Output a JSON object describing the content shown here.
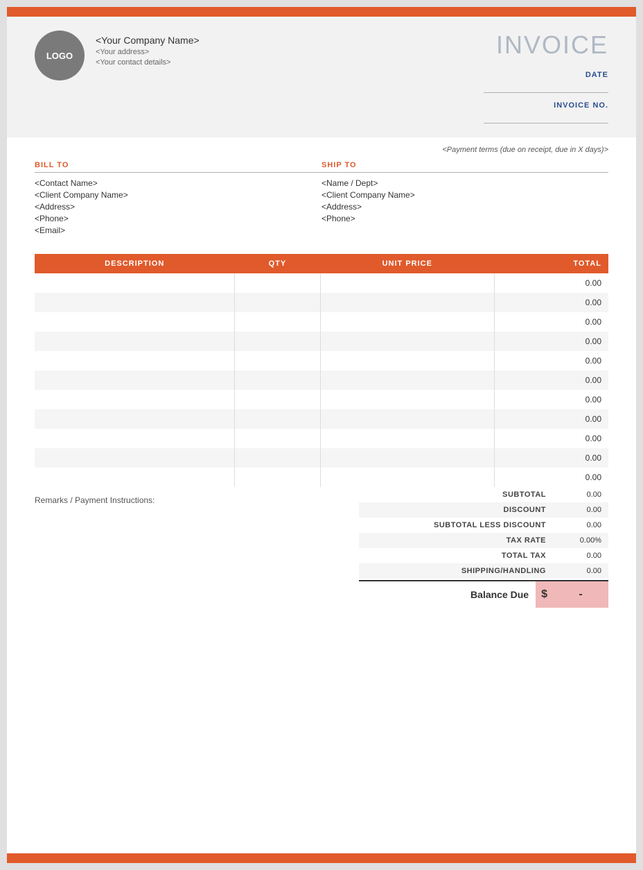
{
  "topBar": {
    "color": "#e05a2b"
  },
  "header": {
    "logo": {
      "label": "LOGO"
    },
    "company": {
      "name": "<Your Company Name>",
      "address": "<Your address>",
      "contact": "<Your contact details>"
    },
    "invoiceTitle": "INVOICE",
    "dateLabel": "DATE",
    "invoiceNoLabel": "INVOICE NO."
  },
  "paymentTerms": "<Payment terms (due on receipt, due in X days)>",
  "billTo": {
    "sectionTitle": "BILL TO",
    "contactName": "<Contact Name>",
    "companyName": "<Client Company Name>",
    "address": "<Address>",
    "phone": "<Phone>",
    "email": "<Email>"
  },
  "shipTo": {
    "sectionTitle": "SHIP TO",
    "nameDept": "<Name / Dept>",
    "companyName": "<Client Company Name>",
    "address": "<Address>",
    "phone": "<Phone>"
  },
  "table": {
    "headers": {
      "description": "DESCRIPTION",
      "qty": "QTY",
      "unitPrice": "UNIT PRICE",
      "total": "TOTAL"
    },
    "rows": [
      {
        "description": "",
        "qty": "",
        "unitPrice": "",
        "total": "0.00"
      },
      {
        "description": "",
        "qty": "",
        "unitPrice": "",
        "total": "0.00"
      },
      {
        "description": "",
        "qty": "",
        "unitPrice": "",
        "total": "0.00"
      },
      {
        "description": "",
        "qty": "",
        "unitPrice": "",
        "total": "0.00"
      },
      {
        "description": "",
        "qty": "",
        "unitPrice": "",
        "total": "0.00"
      },
      {
        "description": "",
        "qty": "",
        "unitPrice": "",
        "total": "0.00"
      },
      {
        "description": "",
        "qty": "",
        "unitPrice": "",
        "total": "0.00"
      },
      {
        "description": "",
        "qty": "",
        "unitPrice": "",
        "total": "0.00"
      },
      {
        "description": "",
        "qty": "",
        "unitPrice": "",
        "total": "0.00"
      },
      {
        "description": "",
        "qty": "",
        "unitPrice": "",
        "total": "0.00"
      },
      {
        "description": "",
        "qty": "",
        "unitPrice": "",
        "total": "0.00"
      }
    ]
  },
  "remarks": "Remarks / Payment Instructions:",
  "totals": {
    "subtotalLabel": "SUBTOTAL",
    "subtotalValue": "0.00",
    "discountLabel": "DISCOUNT",
    "discountValue": "0.00",
    "subtotalLessDiscountLabel": "SUBTOTAL LESS DISCOUNT",
    "subtotalLessDiscountValue": "0.00",
    "taxRateLabel": "TAX RATE",
    "taxRateValue": "0.00%",
    "totalTaxLabel": "TOTAL TAX",
    "totalTaxValue": "0.00",
    "shippingLabel": "SHIPPING/HANDLING",
    "shippingValue": "0.00",
    "balanceDueLabel": "Balance Due",
    "balanceCurrency": "$",
    "balanceDueValue": "-"
  }
}
